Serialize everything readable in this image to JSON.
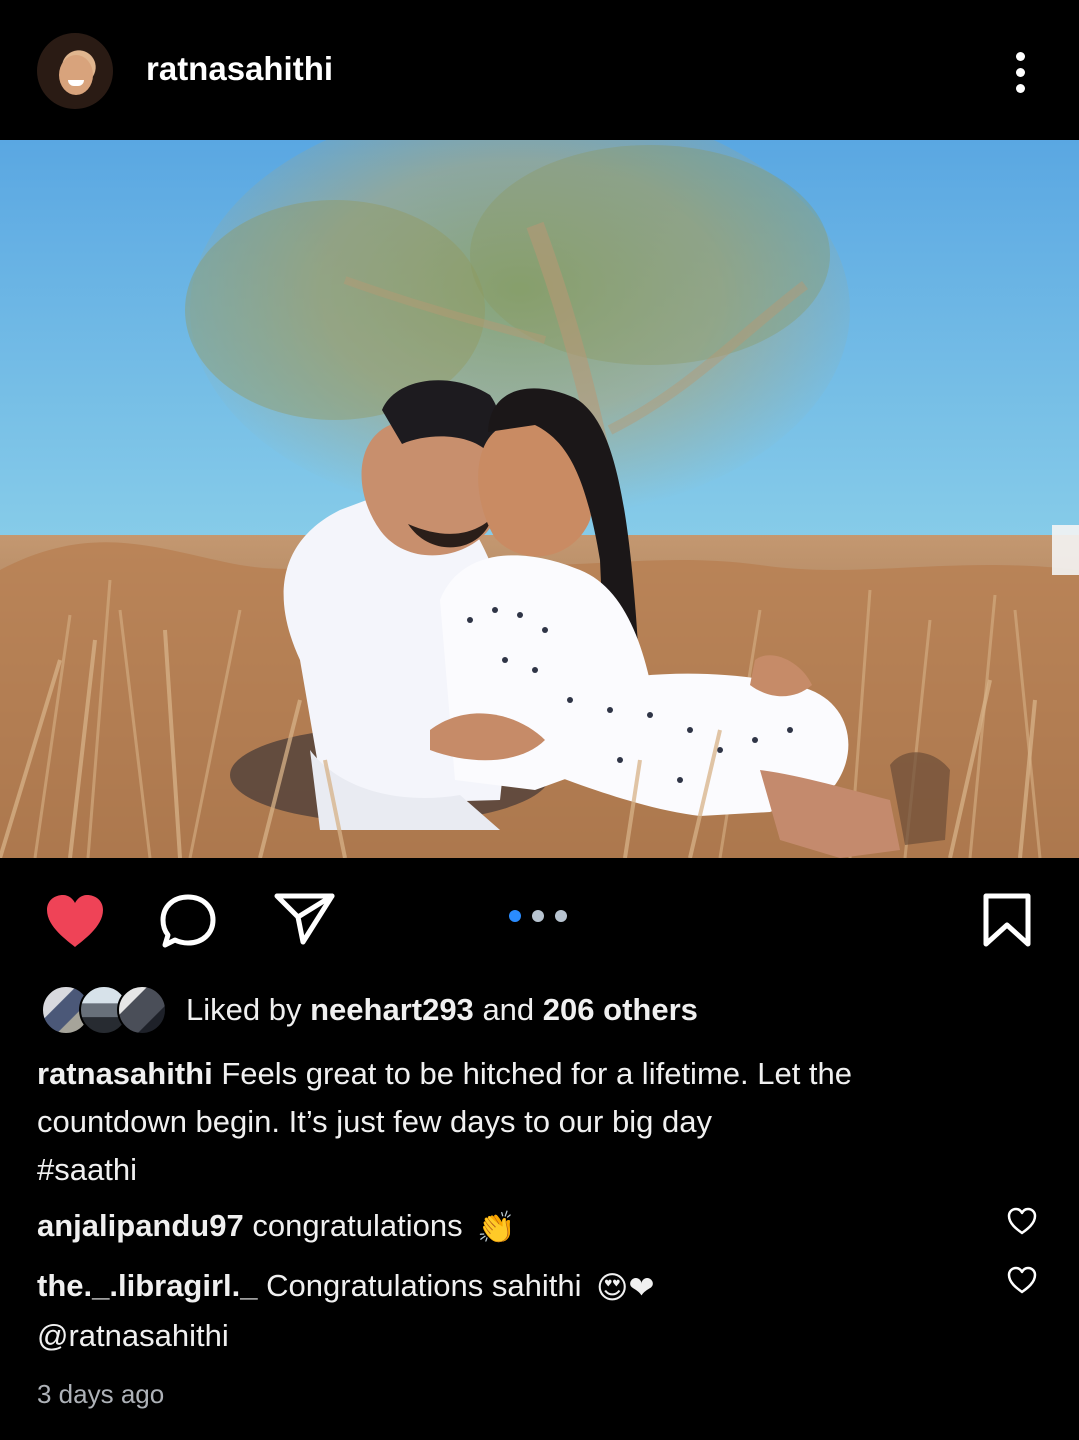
{
  "header": {
    "username": "ratnasahithi",
    "avatar_icon": "profile-avatar",
    "more_icon": "vertical-ellipsis-icon"
  },
  "post": {
    "image_description_icon": "engagement-photo",
    "carousel": {
      "current": 1,
      "total": 3,
      "active_color": "#2a8cff",
      "inactive_color": "#b8c4d0"
    }
  },
  "actions": {
    "like_icon": "heart-filled-icon",
    "comment_icon": "comment-icon",
    "share_icon": "send-icon",
    "bookmark_icon": "bookmark-icon",
    "like_color": "#ef4357"
  },
  "likes": {
    "prefix": "Liked by",
    "user": "neehart293",
    "and": "and",
    "others": "206 others"
  },
  "caption": {
    "username": "ratnasahithi",
    "line1": "Feels great to be hitched for a lifetime. Let the",
    "line2": "countdown begin. It’s just few days to our  big day",
    "line3": "#saathi"
  },
  "comments": [
    {
      "username": "anjalipandu97",
      "text": "congratulations",
      "emoji": "👏"
    },
    {
      "username": "the._.libragirl._",
      "text": "Congratulations sahithi",
      "emoji": "😍❤",
      "mention": "@ratnasahithi"
    }
  ],
  "timestamp": "3 days ago"
}
